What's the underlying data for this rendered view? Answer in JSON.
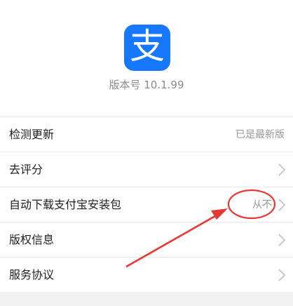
{
  "app": {
    "icon_text": "支",
    "version_label": "版本号 10.1.99"
  },
  "settings": {
    "items": [
      {
        "label": "检测更新",
        "value": "已是最新版",
        "has_chevron": false
      },
      {
        "label": "去评分",
        "value": "",
        "has_chevron": true
      },
      {
        "label": "自动下载支付宝安装包",
        "value": "从不",
        "has_chevron": true
      },
      {
        "label": "版权信息",
        "value": "",
        "has_chevron": true
      },
      {
        "label": "服务协议",
        "value": "",
        "has_chevron": true
      }
    ]
  },
  "colors": {
    "brand": "#1677ff",
    "annotation": "#e53935"
  }
}
